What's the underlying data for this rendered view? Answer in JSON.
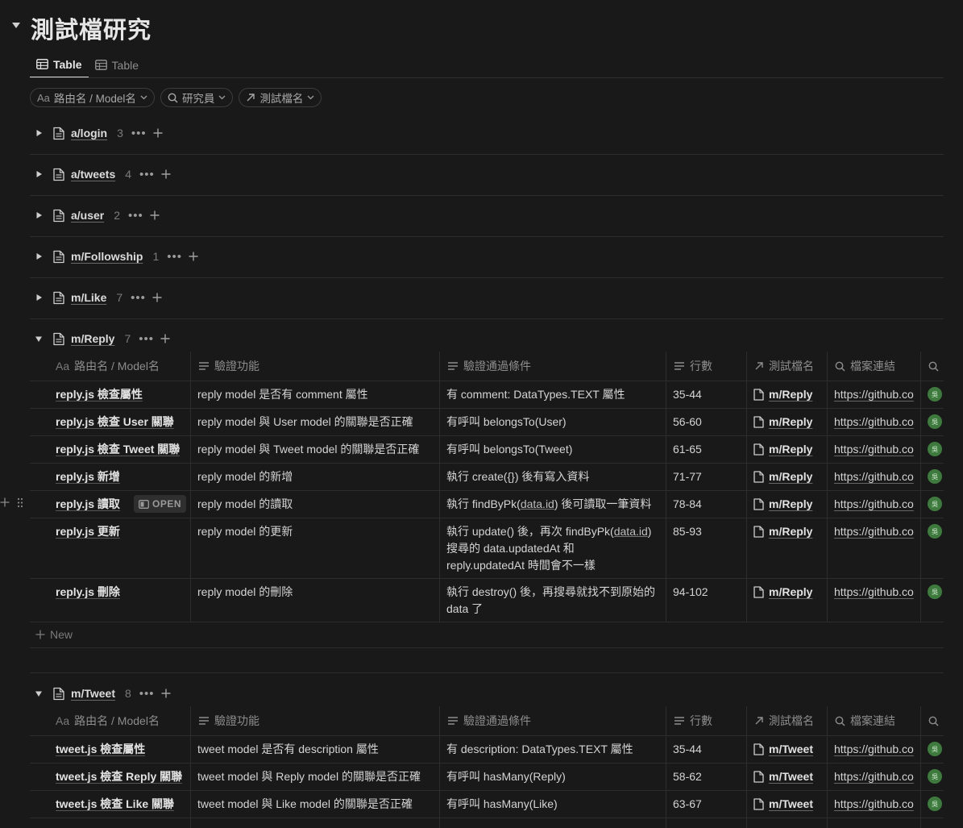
{
  "title": "測試檔研究",
  "tabs": [
    {
      "label": "Table"
    },
    {
      "label": "Table"
    }
  ],
  "filters": [
    {
      "prefix": "Aa",
      "label": "路由名 / Model名"
    },
    {
      "label": "研究員"
    },
    {
      "label": "測試檔名"
    }
  ],
  "groups": [
    {
      "label": "a/login",
      "count": "3"
    },
    {
      "label": "a/tweets",
      "count": "4"
    },
    {
      "label": "a/user",
      "count": "2"
    },
    {
      "label": "m/Followship",
      "count": "1"
    },
    {
      "label": "m/Like",
      "count": "7"
    },
    {
      "label": "m/Reply",
      "count": "7"
    },
    {
      "label": "m/Tweet",
      "count": "8"
    }
  ],
  "columns": {
    "name_prefix": "Aa",
    "name": "路由名 / Model名",
    "feature": "驗證功能",
    "condition": "驗證通過條件",
    "lines": "行數",
    "test_file": "測試檔名",
    "link": "檔案連結"
  },
  "open_label": "OPEN",
  "new_label": "New",
  "avatar_text": "吳",
  "reply_rows": [
    {
      "name": "reply.js 檢查屬性",
      "feature": "reply model 是否有 comment 屬性",
      "cond": "有 comment: DataTypes.TEXT 屬性",
      "lines": "35-44",
      "file": "m/Reply",
      "url": "https://github.co"
    },
    {
      "name": "reply.js 檢查 User 關聯",
      "feature": "reply model 與 User model 的關聯是否正確",
      "cond": "有呼叫 belongsTo(User)",
      "lines": "56-60",
      "file": "m/Reply",
      "url": "https://github.co"
    },
    {
      "name": "reply.js 檢查 Tweet 關聯",
      "feature": "reply model 與 Tweet model 的關聯是否正確",
      "cond": "有呼叫 belongsTo(Tweet)",
      "lines": "61-65",
      "file": "m/Reply",
      "url": "https://github.co"
    },
    {
      "name": "reply.js 新增",
      "feature": "reply model 的新增",
      "cond": "執行 create({}) 後有寫入資料",
      "lines": "71-77",
      "file": "m/Reply",
      "url": "https://github.co"
    },
    {
      "name": "reply.js 讀取",
      "feature": "reply model 的讀取",
      "cond_a": "執行 findByPk(",
      "cond_code": "data.id",
      "cond_b": ") 後可讀取一筆資料",
      "lines": "78-84",
      "file": "m/Reply",
      "url": "https://github.co"
    },
    {
      "name": "reply.js 更新",
      "feature": "reply model 的更新",
      "cond_a": "執行 update() 後，再次 findByPk(",
      "cond_code": "data.id",
      "cond_b": ")",
      "cond_l2": "搜尋的 data.updatedAt 和",
      "cond_l3": "reply.updatedAt 時間會不一樣",
      "lines": "85-93",
      "file": "m/Reply",
      "url": "https://github.co"
    },
    {
      "name": "reply.js 刪除",
      "feature": "reply model 的刪除",
      "cond": "執行 destroy() 後，再搜尋就找不到原始的",
      "cond_l2": "data 了",
      "lines": "94-102",
      "file": "m/Reply",
      "url": "https://github.co"
    }
  ],
  "tweet_rows": [
    {
      "name": "tweet.js 檢查屬性",
      "feature": "tweet model 是否有 description 屬性",
      "cond": "有 description: DataTypes.TEXT 屬性",
      "lines": "35-44",
      "file": "m/Tweet",
      "url": "https://github.co"
    },
    {
      "name": "tweet.js 檢查 Reply 關聯",
      "feature": "tweet model 與 Reply model 的關聯是否正確",
      "cond": "有呼叫 hasMany(Reply)",
      "lines": "58-62",
      "file": "m/Tweet",
      "url": "https://github.co"
    },
    {
      "name": "tweet.js 檢查 Like 關聯",
      "feature": "tweet model 與 Like model 的關聯是否正確",
      "cond": "有呼叫 hasMany(Like)",
      "lines": "63-67",
      "file": "m/Tweet",
      "url": "https://github.co"
    }
  ]
}
